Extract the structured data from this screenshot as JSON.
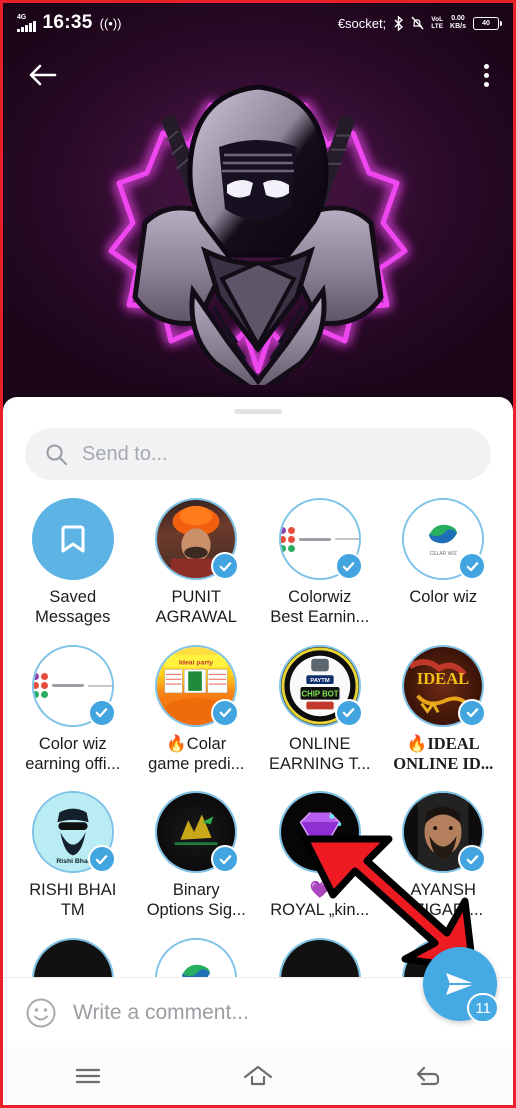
{
  "status_bar": {
    "network_type": "4G",
    "time": "16:35",
    "alarm_icon": "vibrate-icon",
    "bluetooth_icon": "bluetooth-icon",
    "mute_icon": "bell-off-icon",
    "volte_line1": "VoL",
    "volte_line2": "LTE",
    "speed_value": "0.00",
    "speed_unit": "KB/s",
    "battery_level": "40"
  },
  "viewer": {
    "back_label": "back-arrow",
    "menu_label": "more-options",
    "image_description": "hooded ninja assassin mascot with magenta neon glow and dual swords"
  },
  "share_sheet": {
    "search": {
      "placeholder": "Send to...",
      "value": ""
    },
    "contacts": [
      {
        "name": "Saved\nMessages",
        "name_line1": "Saved",
        "name_line2": "Messages",
        "type": "saved",
        "selected": false
      },
      {
        "name_line1": "PUNIT",
        "name_line2": "AGRAWAL",
        "type": "punit",
        "selected": true
      },
      {
        "name_line1": "Colorwiz",
        "name_line2": "Best Earnin...",
        "type": "colorwiz",
        "selected": true
      },
      {
        "name_line1": "Color wiz",
        "name_line2": "",
        "type": "colorwiz2",
        "selected": true
      },
      {
        "name_line1": "Color wiz",
        "name_line2": "earning offi...",
        "type": "colorwiz",
        "selected": true
      },
      {
        "name_line1": "🔥Colar",
        "name_line2": "game predi...",
        "type": "colar",
        "selected": true
      },
      {
        "name_line1": "ONLINE",
        "name_line2": "EARNING T...",
        "type": "online",
        "selected": true
      },
      {
        "name_line1": "🔥IDEAL",
        "name_line2": "ONLINE ID...",
        "type": "ideal",
        "selected": true,
        "serif": true
      },
      {
        "name_line1": "RISHI BHAI",
        "name_line2": "TM",
        "type": "rishi",
        "selected": true
      },
      {
        "name_line1": "Binary",
        "name_line2": "Options Sig...",
        "type": "binary",
        "selected": true
      },
      {
        "name_line1": "💜",
        "name_line2": "ROYAL „kin...",
        "type": "royal",
        "selected": true
      },
      {
        "name_line1": "AYANSH",
        "name_line2": "AZIGAR ...",
        "type": "nayansh",
        "selected": true
      },
      {
        "name_line1": "",
        "name_line2": "",
        "type": "dark",
        "selected": false
      },
      {
        "name_line1": "",
        "name_line2": "",
        "type": "colorwiz2",
        "selected": false
      },
      {
        "name_line1": "",
        "name_line2": "",
        "type": "dark",
        "selected": false
      },
      {
        "name_line1": "",
        "name_line2": "",
        "type": "dark",
        "selected": false
      }
    ]
  },
  "comment_bar": {
    "emoji_icon": "smiley-icon",
    "placeholder": "Write a comment...",
    "value": ""
  },
  "send_button": {
    "icon": "send-plane-icon",
    "badge_count": "11"
  },
  "nav_bar": {
    "recents_label": "recents",
    "home_label": "home",
    "back_label": "back"
  },
  "colors": {
    "accent_blue": "#45aae4",
    "avatar_ring": "#7ec2e8",
    "sheet_bg": "#ffffff",
    "search_bg": "#f1f2f4",
    "arrow_red": "#e8202a",
    "neon_magenta": "#e040e0"
  }
}
